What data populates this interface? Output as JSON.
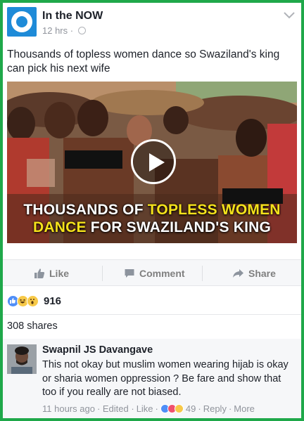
{
  "post": {
    "page_name": "In the NOW",
    "time": "12 hrs",
    "separator": "·",
    "text": "Thousands of topless women dance so Swaziland's king can pick his next wife",
    "video_caption_line1_a": "THOUSANDS OF ",
    "video_caption_line1_b": "TOPLESS WOMEN",
    "video_caption_line2_a": "DANCE",
    "video_caption_line2_b": " FOR SWAZILAND'S KING"
  },
  "actions": {
    "like": "Like",
    "comment": "Comment",
    "share": "Share"
  },
  "reactions": {
    "icons": [
      "like-icon",
      "haha-icon",
      "wow-icon"
    ],
    "count": "916"
  },
  "shares": "308 shares",
  "comment": {
    "author": "Swapnil JS Davangave",
    "text": "This not okay but muslim women wearing hijab is okay or sharia women oppression ? Be fare and show that too if you really are not biased.",
    "time": "11 hours ago",
    "edited": "· Edited ·",
    "like": "Like",
    "dot": "·",
    "reaction_count": "49",
    "reply": "Reply",
    "more": "More"
  },
  "colors": {
    "frame": "#1fa84a",
    "brand": "#1e8bd8",
    "caption_highlight": "#f5e21b"
  }
}
